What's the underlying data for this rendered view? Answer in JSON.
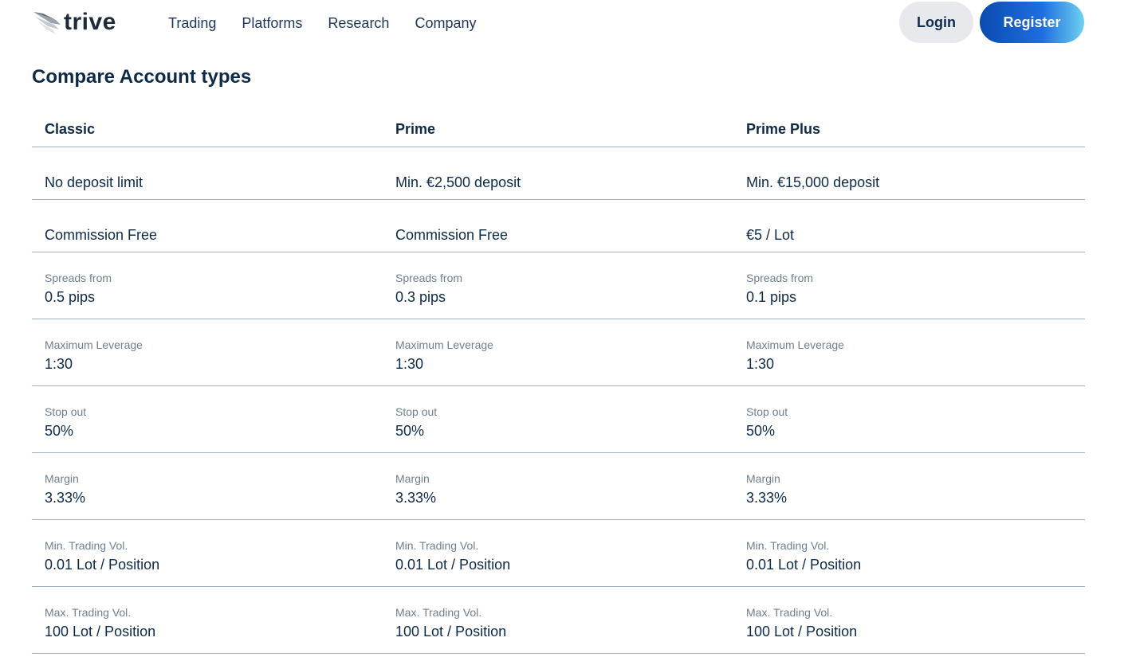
{
  "header": {
    "logo_text": "trive",
    "nav": [
      "Trading",
      "Platforms",
      "Research",
      "Company"
    ],
    "login_label": "Login",
    "register_label": "Register"
  },
  "page_title": "Compare Account types",
  "columns": [
    "Classic",
    "Prime",
    "Prime Plus"
  ],
  "simple_rows": [
    [
      "No deposit limit",
      "Min. €2,500 deposit",
      "Min. €15,000 deposit"
    ],
    [
      "Commission Free",
      "Commission Free",
      "€5 / Lot"
    ]
  ],
  "detail_rows": [
    {
      "label": "Spreads from",
      "values": [
        "0.5 pips",
        "0.3 pips",
        "0.1 pips"
      ]
    },
    {
      "label": "Maximum Leverage",
      "values": [
        "1:30",
        "1:30",
        "1:30"
      ]
    },
    {
      "label": "Stop out",
      "values": [
        "50%",
        "50%",
        "50%"
      ]
    },
    {
      "label": "Margin",
      "values": [
        "3.33%",
        "3.33%",
        "3.33%"
      ]
    },
    {
      "label": "Min. Trading Vol.",
      "values": [
        "0.01 Lot / Position",
        "0.01 Lot / Position",
        "0.01 Lot / Position"
      ]
    },
    {
      "label": "Max. Trading Vol.",
      "values": [
        "100 Lot / Position",
        "100 Lot / Position",
        "100 Lot / Position"
      ]
    }
  ],
  "colors": {
    "brand_blue": "#0a4bb0",
    "text_navy": "#0e2a4a",
    "divider": "#9fb1c1"
  }
}
